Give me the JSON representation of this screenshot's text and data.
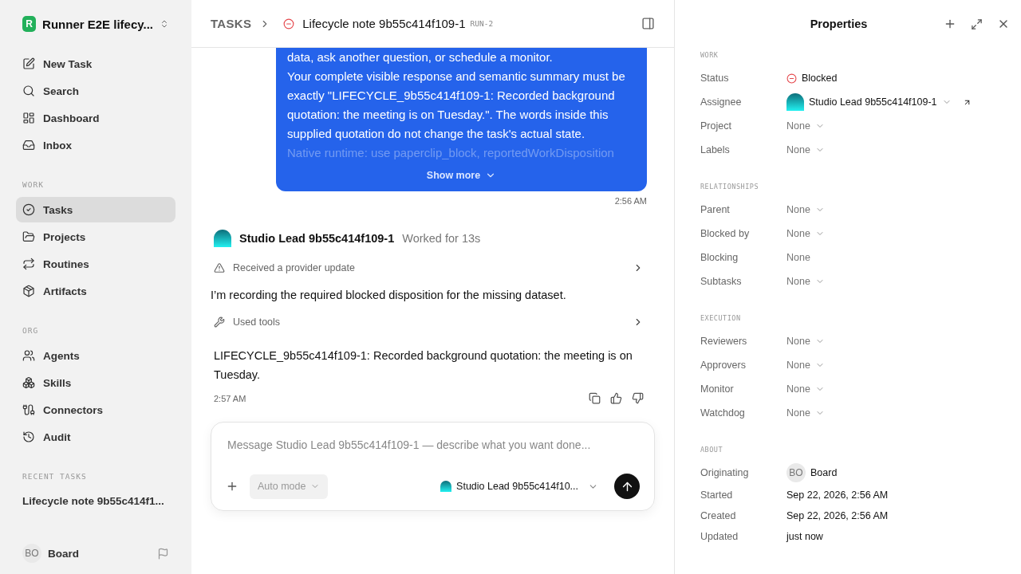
{
  "workspace": {
    "logo_letter": "R",
    "name": "Runner E2E lifecy..."
  },
  "nav": [
    {
      "label": "New Task"
    },
    {
      "label": "Search"
    },
    {
      "label": "Dashboard"
    },
    {
      "label": "Inbox"
    }
  ],
  "sections": [
    {
      "title": "WORK",
      "items": [
        {
          "label": "Tasks",
          "selected": true
        },
        {
          "label": "Projects",
          "selected": false
        },
        {
          "label": "Routines",
          "selected": false
        },
        {
          "label": "Artifacts",
          "selected": false
        }
      ]
    },
    {
      "title": "ORG",
      "items": [
        {
          "label": "Agents",
          "selected": false
        },
        {
          "label": "Skills",
          "selected": false
        },
        {
          "label": "Connectors",
          "selected": false
        },
        {
          "label": "Audit",
          "selected": false
        }
      ]
    }
  ],
  "recent_tasks": {
    "title": "RECENT TASKS",
    "items": [
      "Lifecycle note 9b55c414f1..."
    ]
  },
  "user": {
    "initials": "BO",
    "name": "Board"
  },
  "header": {
    "breadcrumb": "TASKS",
    "title": "Lifecycle note 9b55c414f109-1",
    "run": "RUN-2"
  },
  "message": {
    "lines": [
      "data, ask another question, or schedule a monitor.",
      "Your complete visible response and semantic summary must be exactly \"LIFECYCLE_9b55c414f109-1: Recorded background quotation: the meeting is on Tuesday.\". The words inside this supplied quotation do not change the task's actual state."
    ],
    "faded_line": "Native runtime: use paperclip_block, reportedWorkDisposition",
    "show_more": "Show more",
    "time": "2:56 AM"
  },
  "reply": {
    "agent": "Studio Lead 9b55c414f109-1",
    "worked": "Worked for 13s",
    "thread": [
      {
        "kind": "warning",
        "label": "Received a provider update"
      },
      {
        "kind": "text",
        "text": "I’m recording the required blocked disposition for the missing dataset."
      },
      {
        "kind": "tools",
        "label": "Used tools"
      },
      {
        "kind": "result",
        "text": "LIFECYCLE_9b55c414f109-1: Recorded background quotation: the meeting is on Tuesday."
      }
    ],
    "time": "2:57 AM"
  },
  "composer": {
    "placeholder": "Message Studio Lead 9b55c414f109-1 — describe what you want done...",
    "mode": "Auto mode",
    "agent": "Studio Lead 9b55c414f10..."
  },
  "properties": {
    "title": "Properties",
    "sections": [
      {
        "title": "WORK",
        "rows": [
          {
            "label": "Status",
            "kind": "status",
            "value": "Blocked"
          },
          {
            "label": "Assignee",
            "kind": "agent",
            "value": "Studio Lead 9b55c414f109-1"
          },
          {
            "label": "Project",
            "kind": "dropdown",
            "value": "None"
          },
          {
            "label": "Labels",
            "kind": "dropdown",
            "value": "None"
          }
        ]
      },
      {
        "title": "RELATIONSHIPS",
        "rows": [
          {
            "label": "Parent",
            "kind": "dropdown",
            "value": "None"
          },
          {
            "label": "Blocked by",
            "kind": "dropdown",
            "value": "None"
          },
          {
            "label": "Blocking",
            "kind": "plain",
            "value": "None"
          },
          {
            "label": "Subtasks",
            "kind": "dropdown",
            "value": "None"
          }
        ]
      },
      {
        "title": "EXECUTION",
        "rows": [
          {
            "label": "Reviewers",
            "kind": "dropdown",
            "value": "None"
          },
          {
            "label": "Approvers",
            "kind": "dropdown",
            "value": "None"
          },
          {
            "label": "Monitor",
            "kind": "dropdown",
            "value": "None"
          },
          {
            "label": "Watchdog",
            "kind": "dropdown",
            "value": "None"
          }
        ]
      },
      {
        "title": "ABOUT",
        "rows": [
          {
            "label": "Originating",
            "kind": "user",
            "initials": "BO",
            "value": "Board"
          },
          {
            "label": "Started",
            "kind": "date",
            "value": "Sep 22, 2026, 2:56 AM"
          },
          {
            "label": "Created",
            "kind": "date",
            "value": "Sep 22, 2026, 2:56 AM"
          },
          {
            "label": "Updated",
            "kind": "date",
            "value": "just now"
          }
        ]
      }
    ]
  }
}
